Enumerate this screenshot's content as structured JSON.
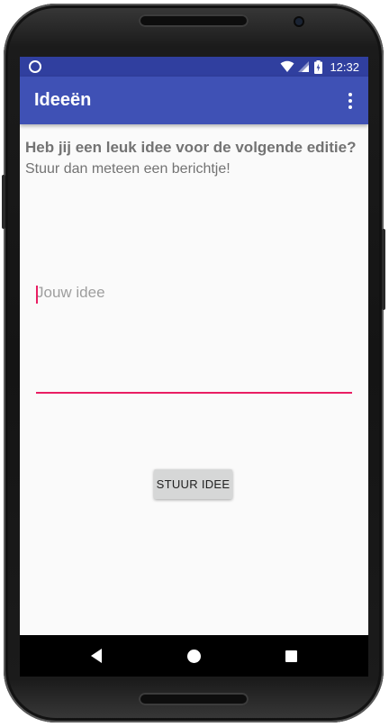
{
  "status_bar": {
    "time": "12:32",
    "icons": [
      "notification-circle-icon",
      "wifi-icon",
      "signal-icon",
      "battery-icon"
    ]
  },
  "app_bar": {
    "title": "Ideeën",
    "menu_icon": "more-vert-icon"
  },
  "main": {
    "heading": "Heb jij een leuk idee voor de volgende editie?",
    "subheading": "Stuur dan meteen een berichtje!",
    "idea_input": {
      "value": "",
      "placeholder": "Jouw idee"
    },
    "send_button_label": "STUUR IDEE"
  },
  "nav_bar": {
    "buttons": [
      "back-icon",
      "home-icon",
      "recents-icon"
    ]
  },
  "colors": {
    "primary": "#3f51b5",
    "primary_dark": "#303f9f",
    "accent": "#e91e63",
    "background": "#fafafa",
    "button": "#d6d7d7",
    "text_secondary": "#737373"
  }
}
